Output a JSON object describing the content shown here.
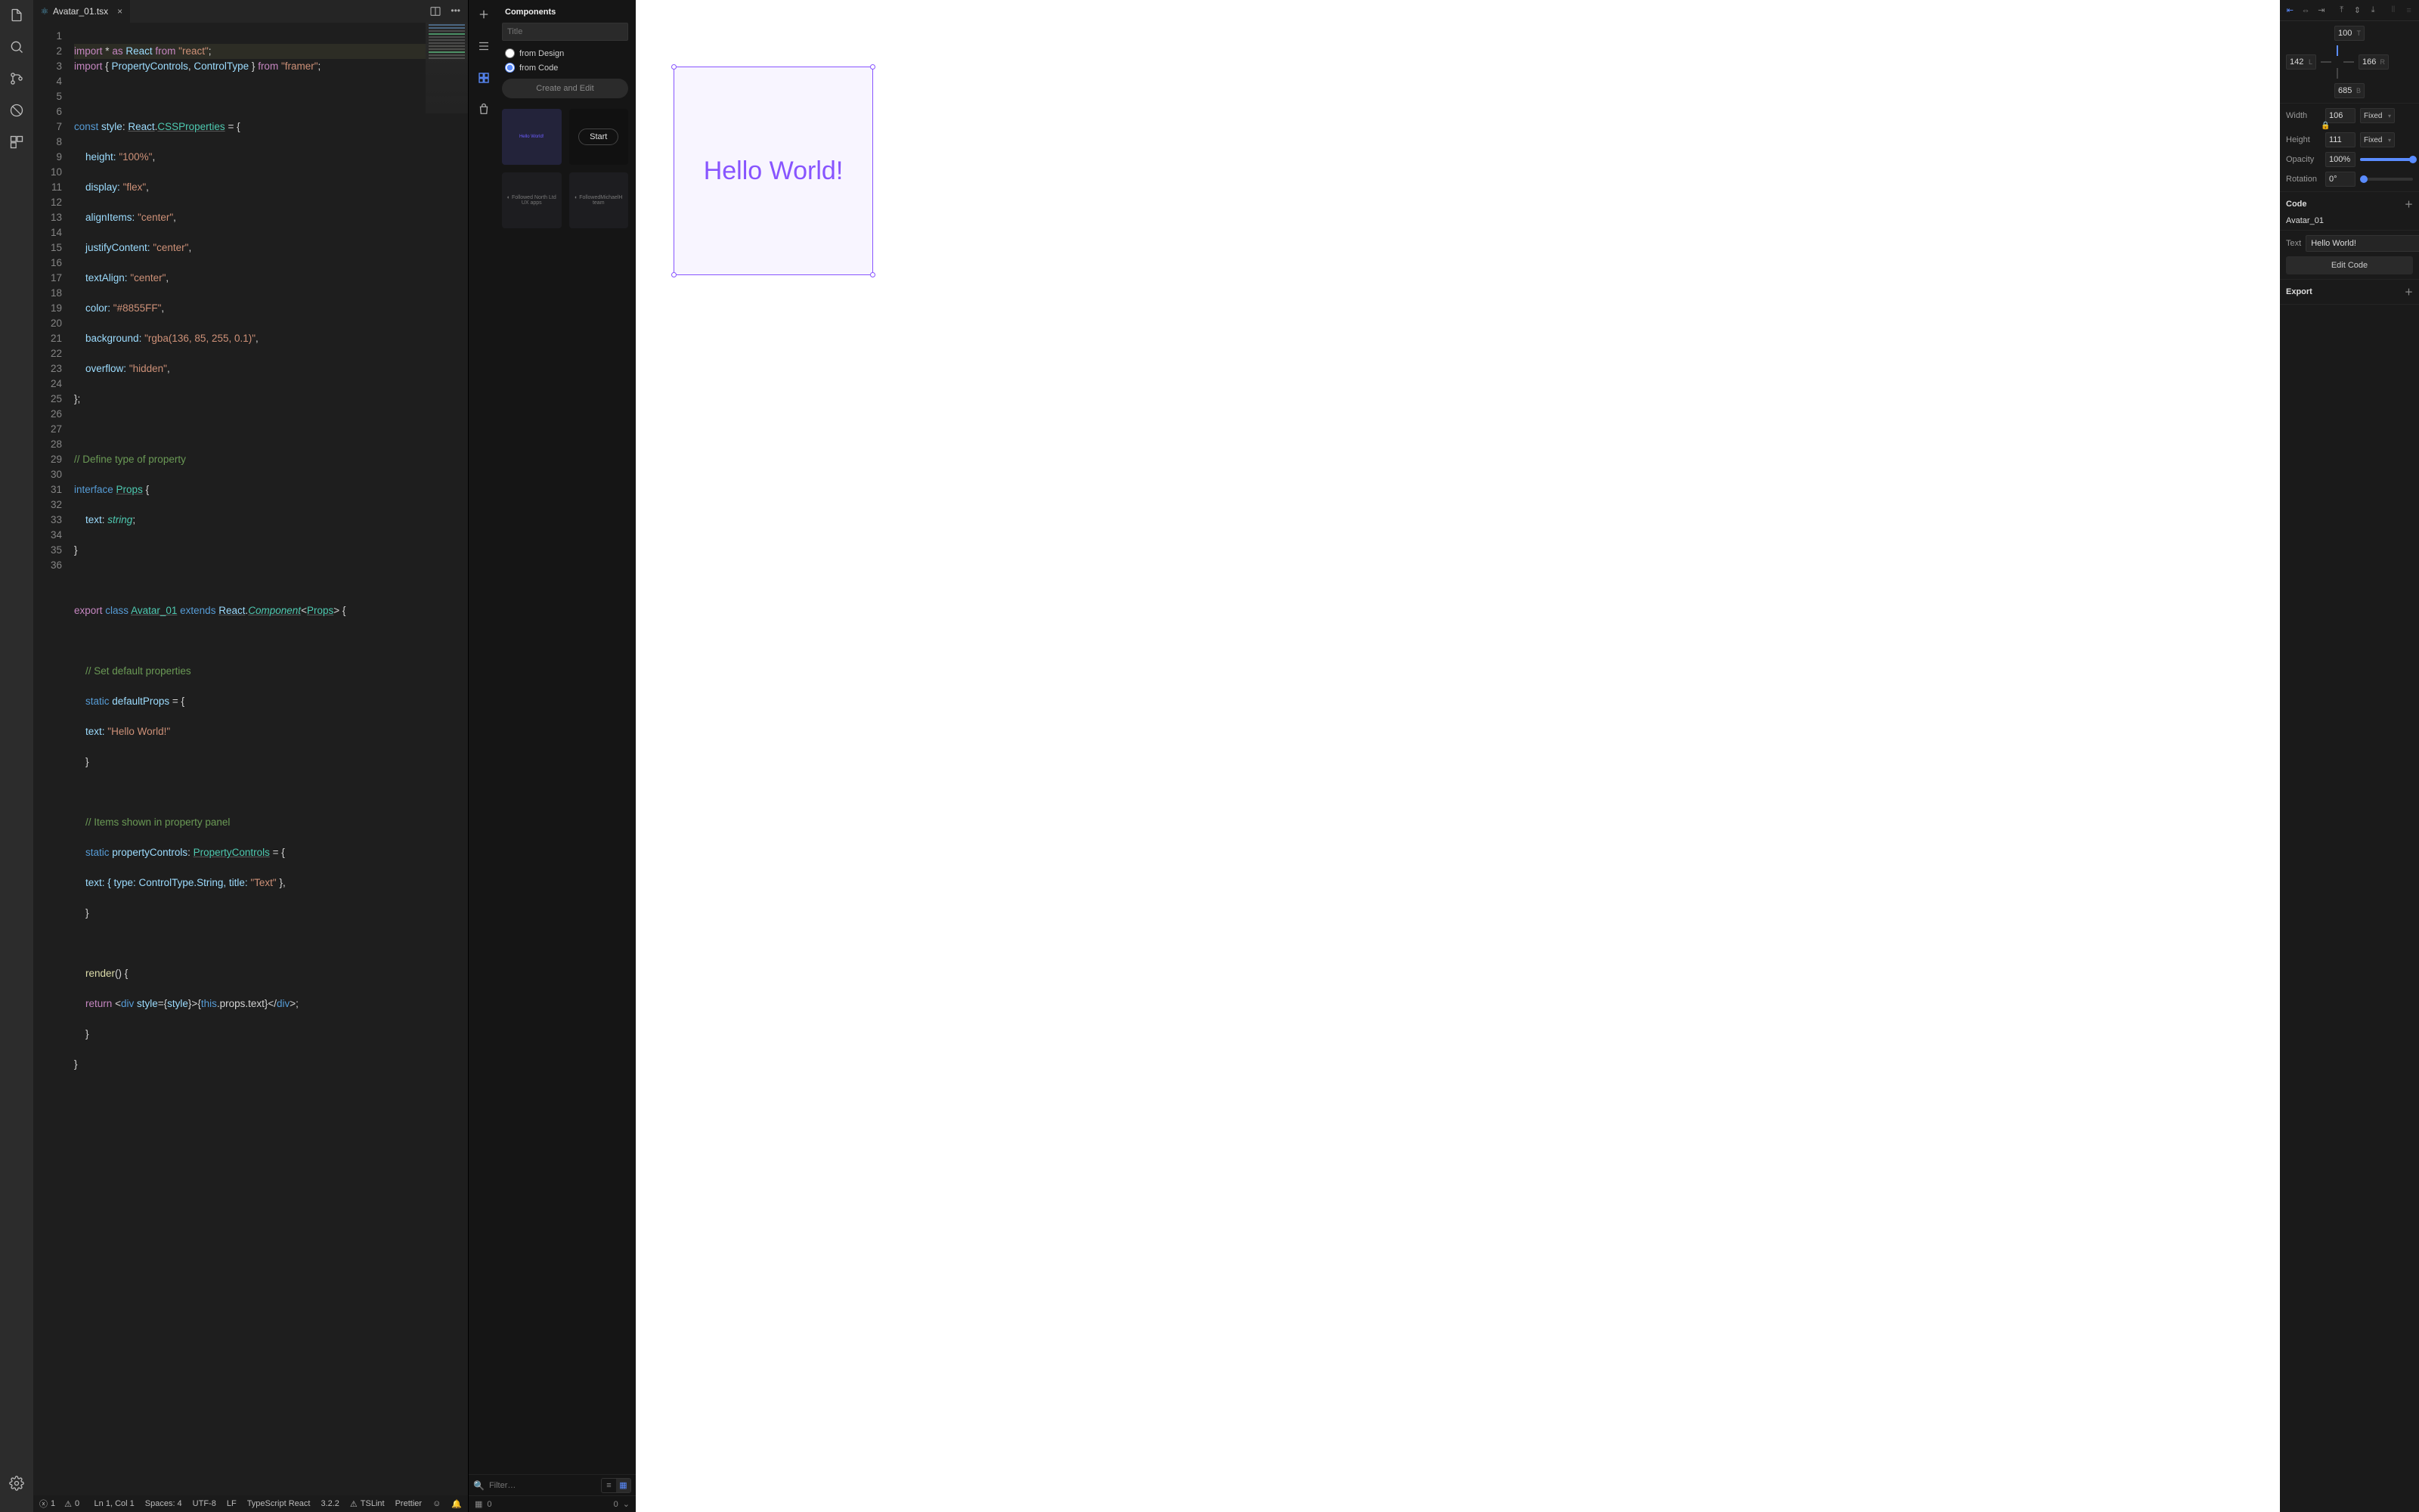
{
  "tab": {
    "filename": "Avatar_01.tsx"
  },
  "toolbar_icons": {
    "split": "split-icon",
    "more": "more-icon"
  },
  "code_lines": 36,
  "status": {
    "errors": "1",
    "warnings": "0",
    "cursor": "Ln 1, Col 1",
    "spaces": "Spaces: 4",
    "encoding": "UTF-8",
    "eol": "LF",
    "lang": "TypeScript React",
    "ts_version": "3.2.2",
    "lint": "TSLint",
    "formatter": "Prettier"
  },
  "components": {
    "title": "Components",
    "title_placeholder": "Title",
    "radio_design": "from Design",
    "radio_code": "from Code",
    "create_btn": "Create and Edit",
    "start_label": "Start",
    "filter_placeholder": "Filter…"
  },
  "components_status": {
    "count": "0",
    "right_count": "0"
  },
  "canvas": {
    "hello": "Hello World!"
  },
  "inspector": {
    "y": "100",
    "y_suf": "T",
    "x": "142",
    "x_suf": "L",
    "r": "166",
    "r_suf": "R",
    "b": "685",
    "b_suf": "B",
    "width_label": "Width",
    "width": "106",
    "width_mode": "Fixed",
    "height_label": "Height",
    "height": "111",
    "height_mode": "Fixed",
    "opacity_label": "Opacity",
    "opacity": "100%",
    "rotation_label": "Rotation",
    "rotation": "0°",
    "code_label": "Code",
    "component_name": "Avatar_01",
    "text_label": "Text",
    "text_value": "Hello World!",
    "edit_btn": "Edit Code",
    "export_label": "Export"
  },
  "source": {
    "l1_import": "import",
    "l1_star": "*",
    "l1_as": "as",
    "l1_React": "React",
    "l1_from": "from",
    "l1_reactstr": "\"react\"",
    "l2_import": "import",
    "l2_pc": "PropertyControls",
    "l2_ct": "ControlType",
    "l2_from": "from",
    "l2_framer": "\"framer\"",
    "l4_const": "const",
    "l4_style": "style",
    "l4_React": "React",
    "l4_css": "CSSProperties",
    "l5_k": "height:",
    "l5_v": "\"100%\"",
    "l6_k": "display:",
    "l6_v": "\"flex\"",
    "l7_k": "alignItems:",
    "l7_v": "\"center\"",
    "l8_k": "justifyContent:",
    "l8_v": "\"center\"",
    "l9_k": "textAlign:",
    "l9_v": "\"center\"",
    "l10_k": "color:",
    "l10_v": "\"#8855FF\"",
    "l11_k": "background:",
    "l11_v": "\"rgba(136, 85, 255, 0.1)\"",
    "l12_k": "overflow:",
    "l12_v": "\"hidden\"",
    "l15": "// Define type of property",
    "l16_interface": "interface",
    "l16_Props": "Props",
    "l17_text": "text",
    "l17_string": "string",
    "l20_export": "export",
    "l20_class": "class",
    "l20_name": "Avatar_01",
    "l20_extends": "extends",
    "l20_React": "React",
    "l20_Component": "Component",
    "l20_Props": "Props",
    "l22": "// Set default properties",
    "l23_static": "static",
    "l23_dp": "defaultProps",
    "l24_text": "text:",
    "l24_v": "\"Hello World!\"",
    "l27": "// Items shown in property panel",
    "l28_static": "static",
    "l28_pc": "propertyControls",
    "l28_type": "PropertyControls",
    "l29": "text: { type: ControlType.String, title: ",
    "l29_v": "\"Text\"",
    "l29_end": " },",
    "l32_render": "render",
    "l33_return": "return",
    "l33_div": "div",
    "l33_style": "style",
    "l33_this": "this"
  }
}
